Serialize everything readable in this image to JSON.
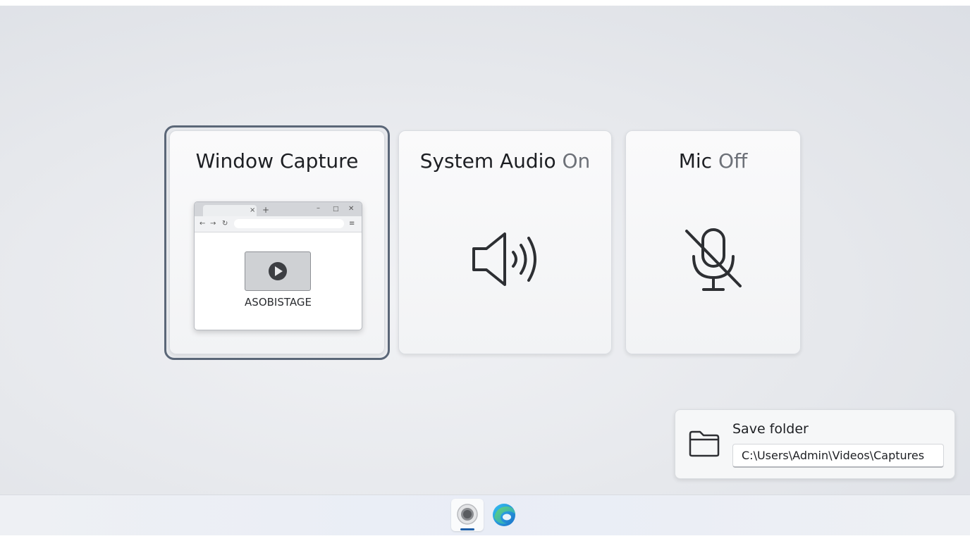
{
  "capture": {
    "window": {
      "title": "Window Capture",
      "thumbnail_caption": "ASOBISTAGE"
    },
    "audio": {
      "title": "System Audio",
      "state": "On"
    },
    "mic": {
      "title": "Mic",
      "state": "Off"
    }
  },
  "save_folder": {
    "label": "Save folder",
    "path": "C:\\Users\\Admin\\Videos\\Captures",
    "icon": "folder-icon"
  },
  "taskbar": {
    "items": [
      {
        "icon": "screen-recorder-icon",
        "active": true
      },
      {
        "icon": "edge-browser-icon",
        "active": false
      }
    ]
  },
  "colors": {
    "selection_ring": "#5b6778",
    "state_text": "#6d7178",
    "taskbar_indicator": "#1f5fa8"
  }
}
